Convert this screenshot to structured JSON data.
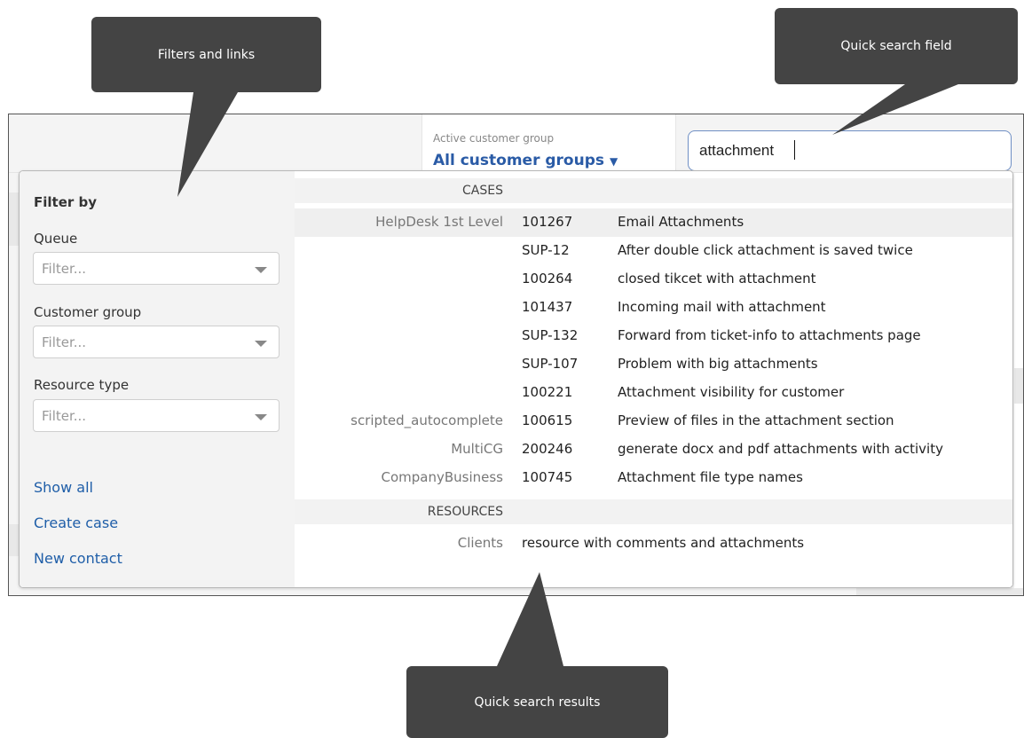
{
  "callouts": {
    "filters": "Filters and links",
    "search": "Quick search field",
    "results": "Quick search results"
  },
  "header": {
    "customer_group_label": "Active customer group",
    "customer_group_value": "All customer groups",
    "search_value": "attachment"
  },
  "filters": {
    "title": "Filter by",
    "queue_label": "Queue",
    "queue_placeholder": "Filter...",
    "customer_group_label": "Customer group",
    "customer_group_placeholder": "Filter...",
    "resource_type_label": "Resource type",
    "resource_type_placeholder": "Filter..."
  },
  "links": {
    "show_all": "Show all",
    "create_case": "Create case",
    "new_contact": "New contact"
  },
  "results": {
    "cases_header": "CASES",
    "cases": [
      {
        "queue": "HelpDesk 1st Level",
        "id": "101267",
        "title": "Email Attachments"
      },
      {
        "queue": "",
        "id": "SUP-12",
        "title": "After double click attachment is saved twice"
      },
      {
        "queue": "",
        "id": "100264",
        "title": "closed tikcet with attachment"
      },
      {
        "queue": "",
        "id": "101437",
        "title": "Incoming mail with attachment"
      },
      {
        "queue": "",
        "id": "SUP-132",
        "title": "Forward from ticket-info to attachments page"
      },
      {
        "queue": "",
        "id": "SUP-107",
        "title": "Problem with big attachments"
      },
      {
        "queue": "",
        "id": "100221",
        "title": "Attachment visibility for customer"
      },
      {
        "queue": "scripted_autocomplete",
        "id": "100615",
        "title": "Preview of files in the attachment section"
      },
      {
        "queue": "MultiCG",
        "id": "200246",
        "title": "generate docx and pdf attachments with activity"
      },
      {
        "queue": "CompanyBusiness",
        "id": "100745",
        "title": "Attachment file type names"
      }
    ],
    "resources_header": "RESOURCES",
    "resources": [
      {
        "type": "Clients",
        "title": "resource with comments and attachments"
      }
    ]
  },
  "colors": {
    "accent": "#2a5ba6",
    "link": "#1f5ea8",
    "callout": "#444444"
  }
}
